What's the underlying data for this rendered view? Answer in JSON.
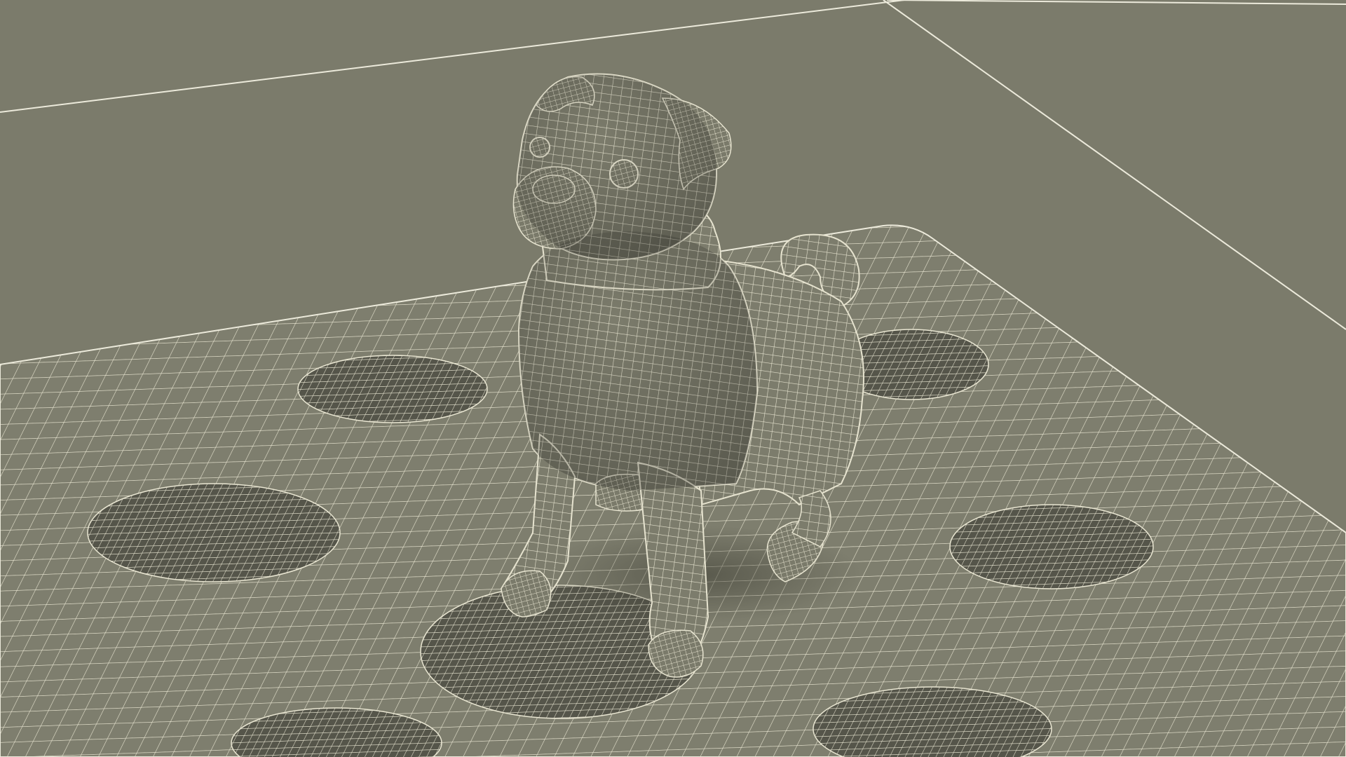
{
  "scene": {
    "background_color": "#7b7b6b",
    "mesh_fill_color": "#7e7e6e",
    "wire_color": "#e9e6d2",
    "shadow_color": "#5c5c4e",
    "subject": "pug-wireframe-model",
    "ground": "quad-mesh-platform"
  }
}
